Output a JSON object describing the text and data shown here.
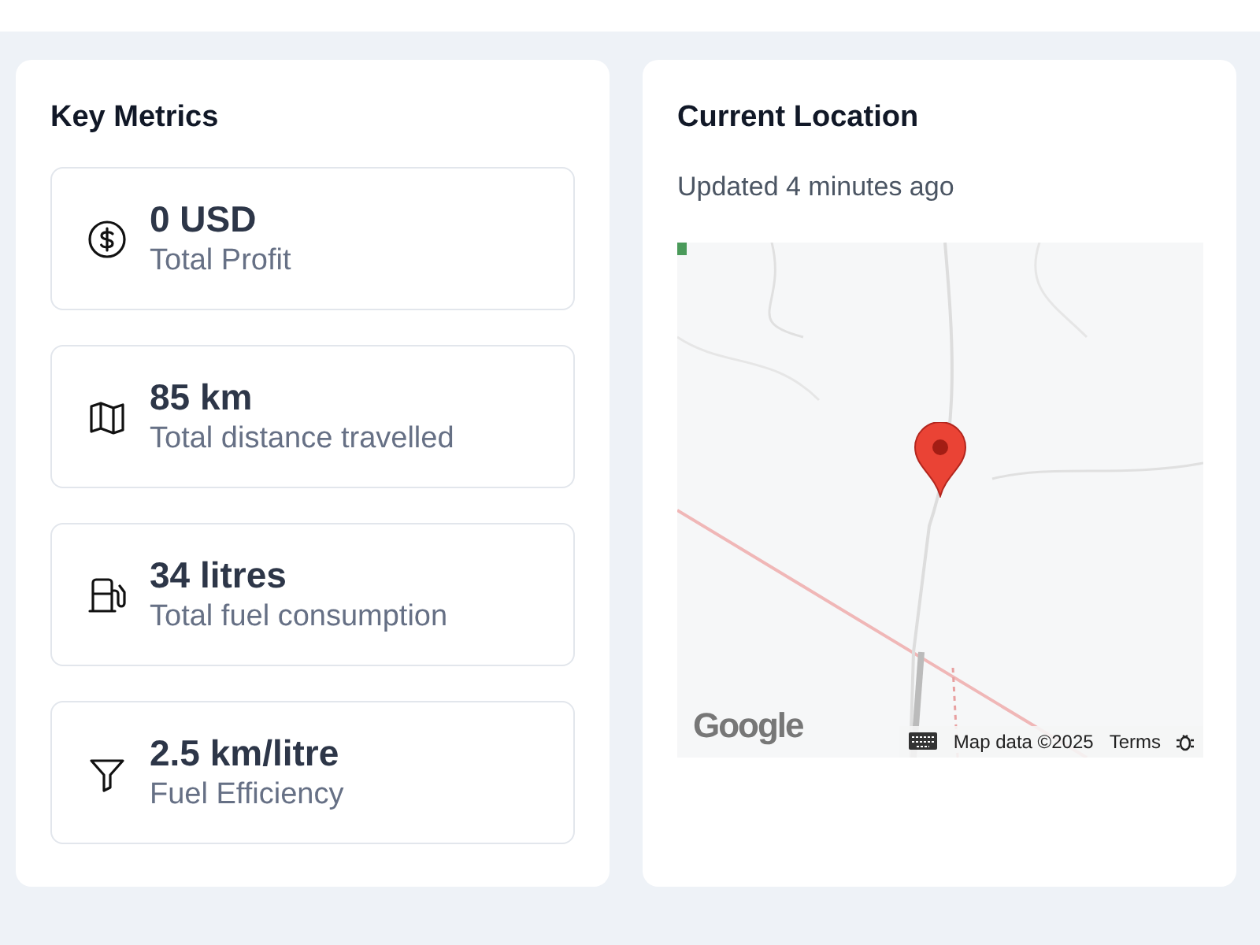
{
  "metrics_card": {
    "title": "Key Metrics",
    "metrics": [
      {
        "kind": "money",
        "value": "0 USD",
        "label": "Total Profit"
      },
      {
        "kind": "map",
        "value": "85 km",
        "label": "Total distance travelled"
      },
      {
        "kind": "fuel",
        "value": "34 litres",
        "label": "Total fuel consumption"
      },
      {
        "kind": "filter",
        "value": "2.5 km/litre",
        "label": "Fuel Efficiency"
      }
    ]
  },
  "location_card": {
    "title": "Current Location",
    "updated": "Updated 4 minutes ago",
    "map": {
      "kind": "picture",
      "logo": "Google",
      "attribution": "Map data ©2025",
      "terms": "Terms"
    }
  }
}
